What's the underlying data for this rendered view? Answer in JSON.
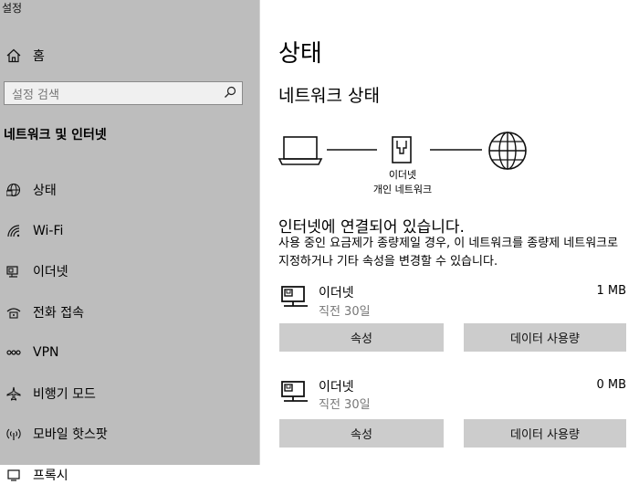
{
  "window": {
    "title": "설정"
  },
  "sidebar": {
    "home_label": "홈",
    "search_placeholder": "설정 검색",
    "section_title": "네트워크 및 인터넷",
    "items": [
      {
        "label": "상태",
        "icon": "globe-icon"
      },
      {
        "label": "Wi-Fi",
        "icon": "wifi-icon"
      },
      {
        "label": "이더넷",
        "icon": "ethernet-icon"
      },
      {
        "label": "전화 접속",
        "icon": "dialup-icon"
      },
      {
        "label": "VPN",
        "icon": "vpn-icon"
      },
      {
        "label": "비행기 모드",
        "icon": "airplane-icon"
      },
      {
        "label": "모바일 핫스팟",
        "icon": "hotspot-icon"
      },
      {
        "label": "프록시",
        "icon": "proxy-icon"
      }
    ]
  },
  "main": {
    "title": "상태",
    "subtitle": "네트워크 상태",
    "diagram": {
      "line1": "이더넷",
      "line2": "개인 네트워크"
    },
    "status_text": "인터넷에 연결되어 있습니다.",
    "description": "사용 중인 요금제가 종량제일 경우, 이 네트워크를 종량제 네트워크로 지정하거나 기타 속성을 변경할 수 있습니다.",
    "connections": [
      {
        "name": "이더넷",
        "time": "직전 30일",
        "usage": "1 MB",
        "properties_label": "속성",
        "data_usage_label": "데이터 사용량"
      },
      {
        "name": "이더넷",
        "time": "직전 30일",
        "usage": "0 MB",
        "properties_label": "속성",
        "data_usage_label": "데이터 사용량"
      }
    ]
  }
}
